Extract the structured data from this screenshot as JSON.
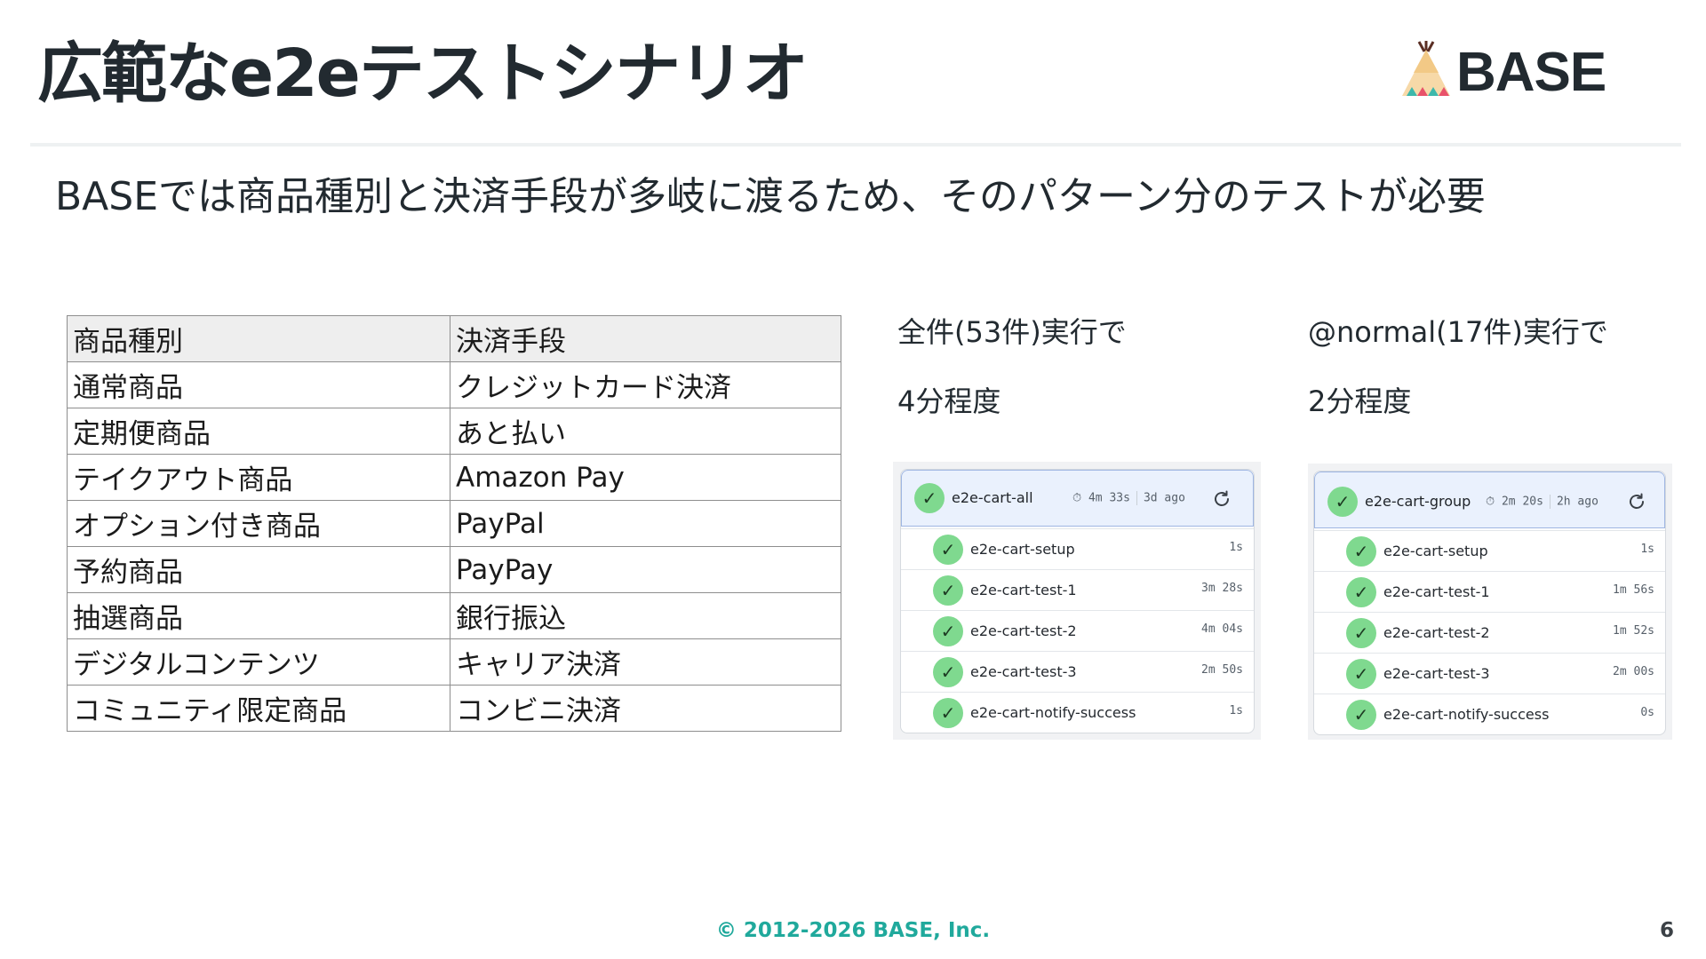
{
  "slide": {
    "title": "広範なe2eテストシナリオ",
    "logo_text": "BASE",
    "lead": "BASEでは商品種別と決済手段が多岐に渡るため、そのパターン分のテストが必要",
    "footer": "© 2012-2026 BASE, Inc.",
    "page_number": "6"
  },
  "table": {
    "headers": [
      "商品種別",
      "決済手段"
    ],
    "rows": [
      [
        "通常商品",
        "クレジットカード決済"
      ],
      [
        "定期便商品",
        "あと払い"
      ],
      [
        "テイクアウト商品",
        "Amazon Pay"
      ],
      [
        "オプション付き商品",
        "PayPal"
      ],
      [
        "予約商品",
        "PayPay"
      ],
      [
        "抽選商品",
        "銀行振込"
      ],
      [
        "デジタルコンテンツ",
        "キャリア決済"
      ],
      [
        "コミュニティ限定商品",
        "コンビニ決済"
      ]
    ]
  },
  "runs": [
    {
      "label_line1": "全件(53件)実行で",
      "label_line2": "4分程度",
      "workflow": {
        "name": "e2e-cart-all",
        "duration": "4m 33s",
        "ago": "3d ago",
        "jobs": [
          {
            "name": "e2e-cart-setup",
            "duration": "1s"
          },
          {
            "name": "e2e-cart-test-1",
            "duration": "3m 28s"
          },
          {
            "name": "e2e-cart-test-2",
            "duration": "4m 04s"
          },
          {
            "name": "e2e-cart-test-3",
            "duration": "2m 50s"
          },
          {
            "name": "e2e-cart-notify-success",
            "duration": "1s"
          }
        ]
      }
    },
    {
      "label_line1": "@normal(17件)実行で",
      "label_line2": "2分程度",
      "workflow": {
        "name": "e2e-cart-group",
        "duration": "2m 20s",
        "ago": "2h ago",
        "jobs": [
          {
            "name": "e2e-cart-setup",
            "duration": "1s"
          },
          {
            "name": "e2e-cart-test-1",
            "duration": "1m 56s"
          },
          {
            "name": "e2e-cart-test-2",
            "duration": "1m 52s"
          },
          {
            "name": "e2e-cart-test-3",
            "duration": "2m 00s"
          },
          {
            "name": "e2e-cart-notify-success",
            "duration": "0s"
          }
        ]
      }
    }
  ],
  "icons": {
    "status": "check-icon",
    "timer": "stopwatch-icon",
    "rerun": "rerun-icon"
  },
  "colors": {
    "success": "#7fd98f",
    "footer": "#20a99c",
    "header_bg": "#eaf1fd"
  }
}
